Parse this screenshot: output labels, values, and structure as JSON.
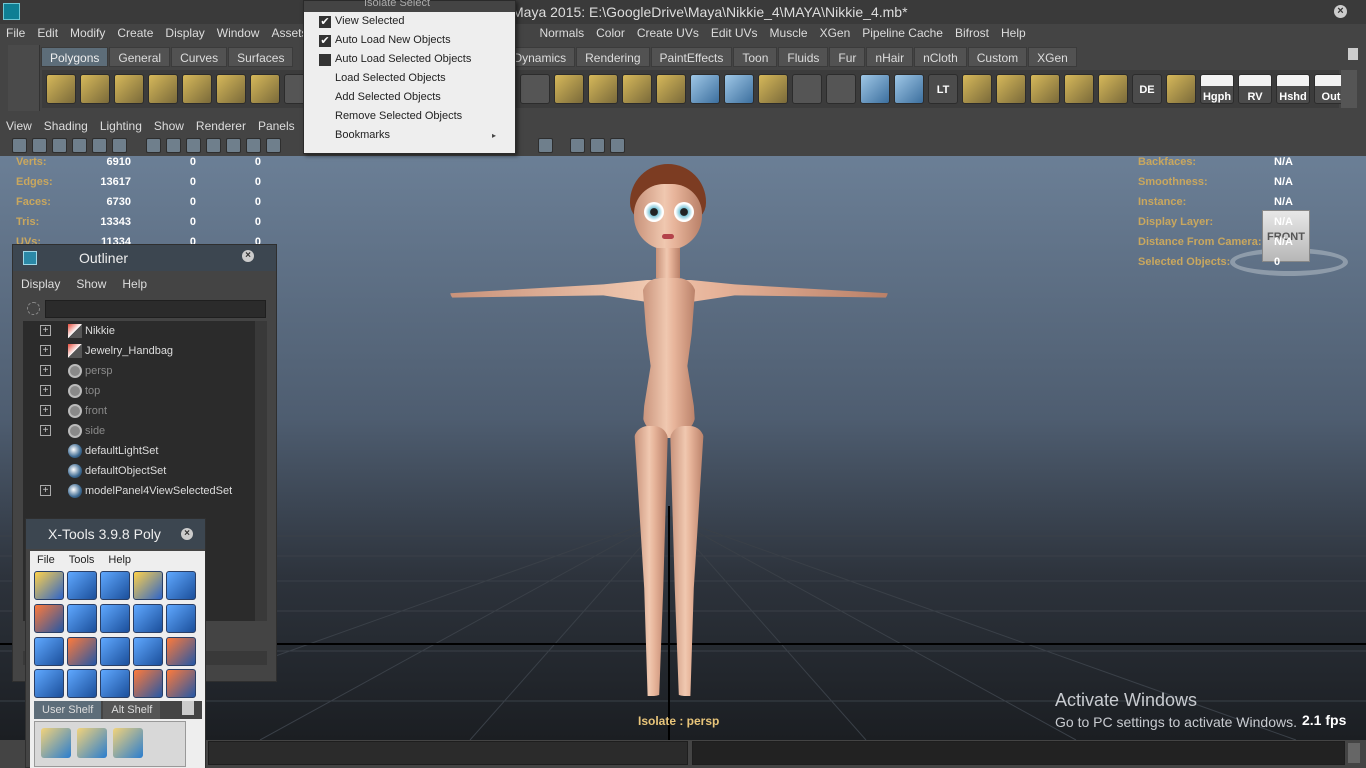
{
  "window": {
    "title": "Maya 2015: E:\\GoogleDrive\\Maya\\Nikkie_4\\MAYA\\Nikkie_4.mb*",
    "close_icon": "close-icon"
  },
  "main_menu": [
    "File",
    "Edit",
    "Modify",
    "Create",
    "Display",
    "Window",
    "Assets",
    "Normals",
    "Color",
    "Create UVs",
    "Edit UVs",
    "Muscle",
    "XGen",
    "Pipeline Cache",
    "Bifrost",
    "Help"
  ],
  "shelf_tabs": [
    "Polygons",
    "General",
    "Curves",
    "Surfaces",
    "Dynamics",
    "Rendering",
    "PaintEffects",
    "Toon",
    "Fluids",
    "Fur",
    "nHair",
    "nCloth",
    "Custom",
    "XGen"
  ],
  "shelf_labels": {
    "lt": "LT",
    "de": "DE",
    "hgph": "Hgph",
    "rv": "RV",
    "hshd": "Hshd",
    "out": "Out"
  },
  "panel_menu": [
    "View",
    "Shading",
    "Lighting",
    "Show",
    "Renderer",
    "Panels"
  ],
  "hud": {
    "left_labels": [
      "Verts:",
      "Edges:",
      "Faces:",
      "Tris:",
      "UVs:"
    ],
    "left_values": [
      [
        "6910",
        "0",
        "0"
      ],
      [
        "13617",
        "0",
        "0"
      ],
      [
        "6730",
        "0",
        "0"
      ],
      [
        "13343",
        "0",
        "0"
      ],
      [
        "11334",
        "0",
        "0"
      ]
    ],
    "right_labels": [
      "Backfaces:",
      "Smoothness:",
      "Instance:",
      "Display Layer:",
      "Distance From Camera:",
      "Selected Objects:"
    ],
    "right_values": [
      "N/A",
      "N/A",
      "N/A",
      "N/A",
      "N/A",
      "0"
    ],
    "isolate": "Isolate : persp",
    "fps": "2.1 fps",
    "view_cube": "FRONT"
  },
  "watermark": {
    "title": "Activate Windows",
    "subtitle": "Go to PC settings to activate Windows."
  },
  "isolate_menu": {
    "header": "Isolate Select",
    "items": [
      {
        "label": "View Selected",
        "checked": "✔"
      },
      {
        "label": "Auto Load New Objects",
        "checked": "✔"
      },
      {
        "label": "Auto Load Selected Objects",
        "checked": ""
      },
      {
        "label": "Load Selected Objects"
      },
      {
        "label": "Add Selected Objects"
      },
      {
        "label": "Remove Selected Objects"
      },
      {
        "label": "Bookmarks",
        "submenu": "▸"
      }
    ]
  },
  "outliner": {
    "title": "Outliner",
    "menu": [
      "Display",
      "Show",
      "Help"
    ],
    "items": [
      {
        "label": "Nikkie",
        "icon": "transform-icon",
        "expand": "+"
      },
      {
        "label": "Jewelry_Handbag",
        "icon": "transform-icon",
        "expand": "+"
      },
      {
        "label": "persp",
        "icon": "camera-icon",
        "expand": "+"
      },
      {
        "label": "top",
        "icon": "camera-icon",
        "expand": "+"
      },
      {
        "label": "front",
        "icon": "camera-icon",
        "expand": "+"
      },
      {
        "label": "side",
        "icon": "camera-icon",
        "expand": "+"
      },
      {
        "label": "defaultLightSet",
        "icon": "set-icon",
        "expand": ""
      },
      {
        "label": "defaultObjectSet",
        "icon": "set-icon",
        "expand": ""
      },
      {
        "label": "modelPanel4ViewSelectedSet",
        "icon": "set-icon",
        "expand": "+"
      }
    ]
  },
  "xtools": {
    "title": "X-Tools 3.9.8 Poly",
    "menu": [
      "File",
      "Tools",
      "Help"
    ],
    "tabs": [
      "User Shelf",
      "Alt Shelf"
    ]
  },
  "colors": {
    "accent": "#5d6d79",
    "hud_label": "#c9a75e"
  }
}
